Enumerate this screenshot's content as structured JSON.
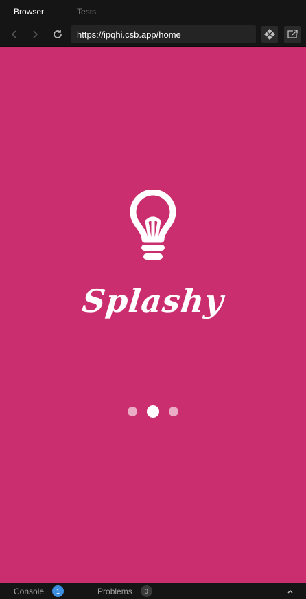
{
  "tabs": [
    {
      "label": "Browser",
      "active": true
    },
    {
      "label": "Tests",
      "active": false
    }
  ],
  "navbar": {
    "url": "https://ipqhi.csb.app/home",
    "icons": [
      "chevron-left-icon",
      "chevron-right-icon",
      "reload-icon",
      "codesandbox-icon",
      "open-in-new-window-icon"
    ]
  },
  "preview": {
    "background": "#cb2e6e",
    "logo_icon": "lightbulb-icon",
    "brand": "Splashy",
    "loader": {
      "dots": 3,
      "active_index": 1
    }
  },
  "bottombar": {
    "console_label": "Console",
    "console_count": "1",
    "problems_label": "Problems",
    "problems_count": "0",
    "collapse_icon": "chevron-up-icon"
  },
  "colors": {
    "chrome_bg": "#151515",
    "url_bg": "#242424",
    "accent_blue": "#3c8fe0",
    "brand_pink": "#cb2e6e"
  }
}
